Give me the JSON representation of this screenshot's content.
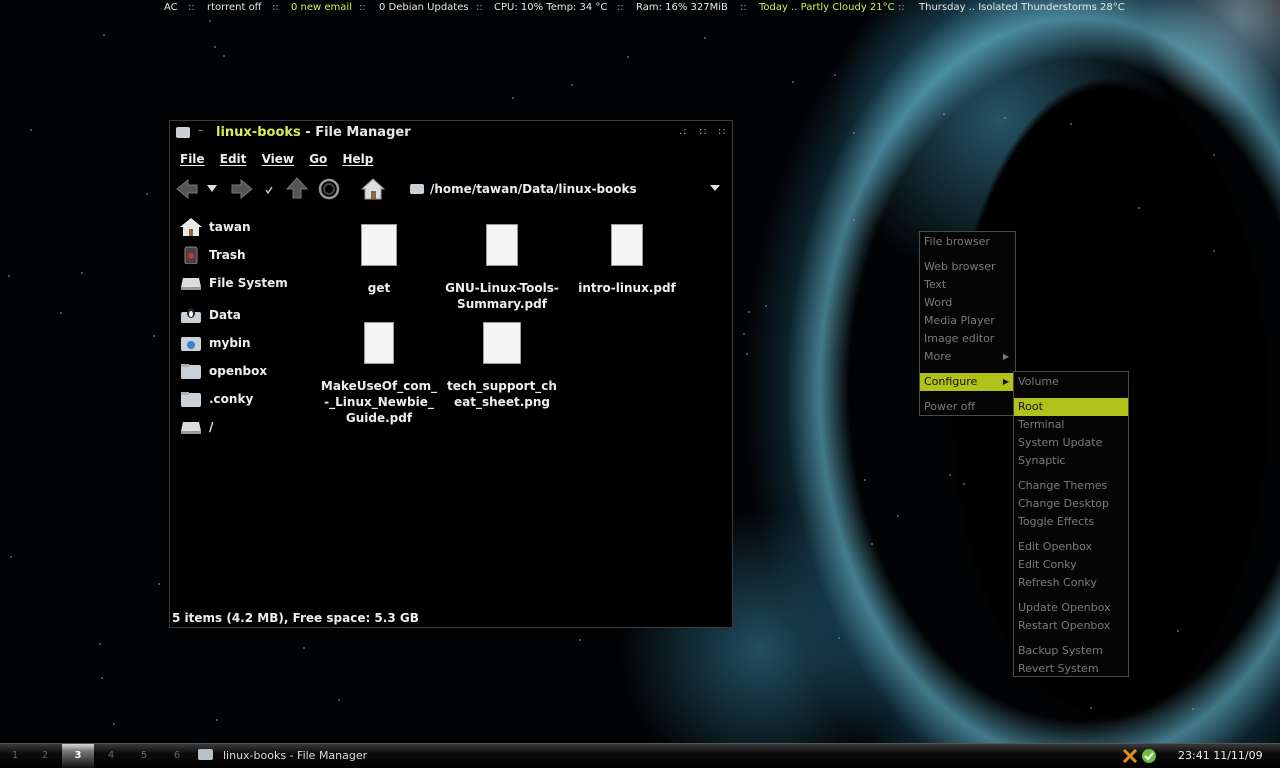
{
  "topbar": {
    "ac": "AC",
    "rtorrent": "rtorrent off",
    "email": "0 new email",
    "updates": "0 Debian Updates",
    "cpu": "CPU: 10%  Temp: 34 °C",
    "ram": "Ram: 16%  327MiB",
    "today": "Today .. Partly Cloudy 21°C",
    "thursday": "Thursday .. Isolated Thunderstorms 28°C",
    "separator": "::"
  },
  "window": {
    "shade_glyph": "–",
    "title_folder": "linux-books",
    "title_app": " - File Manager",
    "controls": {
      "iconify": ".:",
      "maximize": "::",
      "close": "::"
    },
    "menu": [
      "File",
      "Edit",
      "View",
      "Go",
      "Help"
    ],
    "toolbar": {
      "back_icon": "back-arrow-icon",
      "forward_icon": "forward-arrow-icon",
      "up_icon": "up-arrow-icon",
      "reload_icon": "reload-icon",
      "home_icon": "home-icon",
      "path": "/home/tawan/Data/linux-books"
    },
    "sidebar": [
      {
        "label": "tawan",
        "icon": "home-folder-icon"
      },
      {
        "label": "Trash",
        "icon": "trash-icon"
      },
      {
        "label": "File System",
        "icon": "drive-icon"
      },
      {
        "label": "Data",
        "icon": "linux-drive-icon"
      },
      {
        "label": "mybin",
        "icon": "folder-icon"
      },
      {
        "label": "openbox",
        "icon": "folder-icon"
      },
      {
        "label": ".conky",
        "icon": "folder-icon"
      },
      {
        "label": "/",
        "icon": "drive-icon"
      }
    ],
    "files": [
      {
        "name": "get"
      },
      {
        "name": "GNU-Linux-Tools-Summary.pdf"
      },
      {
        "name": "intro-linux.pdf"
      },
      {
        "name": "MakeUseOf_com_-_Linux_Newbie_Guide.pdf"
      },
      {
        "name": "tech_support_cheat_sheet.png"
      }
    ],
    "status": "5 items (4.2 MB), Free space: 5.3 GB"
  },
  "root_menu": {
    "items": [
      "File browser",
      "Web browser",
      "Text",
      "Word",
      "Media Player",
      "Image editor",
      "More",
      "Configure",
      "Power off"
    ]
  },
  "configure_menu": {
    "items": [
      "Volume",
      "Root",
      "Terminal",
      "System Update",
      "Synaptic",
      "Change Themes",
      "Change Desktop",
      "Toggle Effects",
      "Edit Openbox",
      "Edit Conky",
      "Refresh Conky",
      "Update Openbox",
      "Restart Openbox",
      "Backup System",
      "Revert System"
    ]
  },
  "taskbar": {
    "workspaces": [
      "1",
      "2",
      "3",
      "4",
      "5",
      "6"
    ],
    "current_workspace": "3",
    "task": "linux-books - File Manager",
    "clock": "23:41 11/11/09"
  },
  "colors": {
    "accent": "#b1c31a",
    "title_highlight": "#d6f05a"
  }
}
